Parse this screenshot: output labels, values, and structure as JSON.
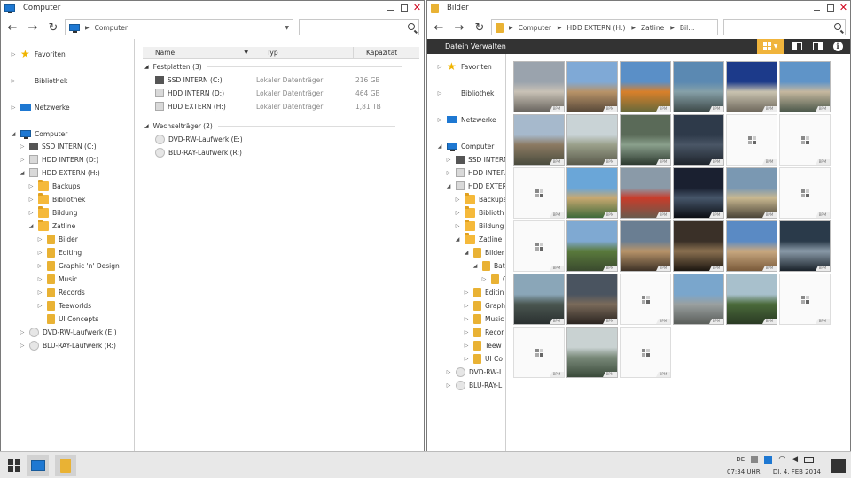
{
  "left_window": {
    "title": "Computer",
    "address": [
      "Computer"
    ],
    "tree": [
      {
        "label": "Favoriten",
        "icon": "star-icon",
        "level": 0,
        "expander": "collapsed"
      },
      {
        "label": "Bibliothek",
        "icon": "library-icon",
        "level": 0,
        "expander": "collapsed"
      },
      {
        "label": "Netzwerke",
        "icon": "network-icon",
        "level": 0,
        "expander": "collapsed"
      },
      {
        "label": "Computer",
        "icon": "monitor-icon",
        "level": 0,
        "expander": "expanded"
      },
      {
        "label": "SSD INTERN (C:)",
        "icon": "ssd-icon",
        "level": 1,
        "expander": "collapsed"
      },
      {
        "label": "HDD INTERN (D:)",
        "icon": "drive-icon",
        "level": 1,
        "expander": "collapsed"
      },
      {
        "label": "HDD EXTERN (H:)",
        "icon": "drive-icon",
        "level": 1,
        "expander": "expanded"
      },
      {
        "label": "Backups",
        "icon": "folder-icon",
        "level": 2,
        "expander": "collapsed"
      },
      {
        "label": "Bibliothek",
        "icon": "folder-icon",
        "level": 2,
        "expander": "collapsed"
      },
      {
        "label": "Bildung",
        "icon": "folder-icon",
        "level": 2,
        "expander": "collapsed"
      },
      {
        "label": "Zatline",
        "icon": "folder-icon",
        "level": 2,
        "expander": "expanded"
      },
      {
        "label": "Bilder",
        "icon": "book-folder-icon",
        "level": 3,
        "expander": "collapsed"
      },
      {
        "label": "Editing",
        "icon": "book-folder-icon",
        "level": 3,
        "expander": "collapsed"
      },
      {
        "label": "Graphic 'n' Design",
        "icon": "book-folder-icon",
        "level": 3,
        "expander": "collapsed"
      },
      {
        "label": "Music",
        "icon": "book-folder-icon",
        "level": 3,
        "expander": "collapsed"
      },
      {
        "label": "Records",
        "icon": "book-folder-icon",
        "level": 3,
        "expander": "collapsed"
      },
      {
        "label": "Teeworlds",
        "icon": "book-folder-icon",
        "level": 3,
        "expander": "collapsed"
      },
      {
        "label": "UI Concepts",
        "icon": "book-folder-icon",
        "level": 3,
        "expander": "none"
      },
      {
        "label": "DVD-RW-Laufwerk (E:)",
        "icon": "disc-icon",
        "level": 1,
        "expander": "collapsed"
      },
      {
        "label": "BLU-RAY-Laufwerk (R:)",
        "icon": "disc-icon",
        "level": 1,
        "expander": "collapsed"
      }
    ],
    "columns": [
      "Name",
      "Typ",
      "Kapazität"
    ],
    "groups": [
      {
        "label": "Festplatten (3)",
        "items": [
          {
            "name": "SSD INTERN (C:)",
            "type": "Lokaler Datenträger",
            "capacity": "216 GB",
            "icon": "ssd-icon"
          },
          {
            "name": "HDD INTERN (D:)",
            "type": "Lokaler Datenträger",
            "capacity": "464 GB",
            "icon": "drive-icon"
          },
          {
            "name": "HDD EXTERN (H:)",
            "type": "Lokaler Datenträger",
            "capacity": "1,81 TB",
            "icon": "drive-icon"
          }
        ]
      },
      {
        "label": "Wechselträger (2)",
        "items": [
          {
            "name": "DVD-RW-Laufwerk (E:)",
            "type": "",
            "capacity": "",
            "icon": "disc-icon"
          },
          {
            "name": "BLU-RAY-Laufwerk (R:)",
            "type": "",
            "capacity": "",
            "icon": "disc-icon"
          }
        ]
      }
    ]
  },
  "right_window": {
    "title": "Bilder",
    "address": [
      "Computer",
      "HDD EXTERN (H:)",
      "Zatline",
      "Bil..."
    ],
    "toolbar_label": "Datein Verwalten",
    "tree": [
      {
        "label": "Favoriten",
        "icon": "star-icon",
        "level": 0,
        "expander": "collapsed"
      },
      {
        "label": "Bibliothek",
        "icon": "library-icon",
        "level": 0,
        "expander": "collapsed"
      },
      {
        "label": "Netzwerke",
        "icon": "network-icon",
        "level": 0,
        "expander": "collapsed"
      },
      {
        "label": "Computer",
        "icon": "monitor-icon",
        "level": 0,
        "expander": "expanded"
      },
      {
        "label": "SSD INTERN",
        "icon": "ssd-icon",
        "level": 1,
        "expander": "collapsed"
      },
      {
        "label": "HDD INTER",
        "icon": "drive-icon",
        "level": 1,
        "expander": "collapsed"
      },
      {
        "label": "HDD EXTER",
        "icon": "drive-icon",
        "level": 1,
        "expander": "expanded"
      },
      {
        "label": "Backups",
        "icon": "folder-icon",
        "level": 2,
        "expander": "collapsed"
      },
      {
        "label": "Biblioth",
        "icon": "folder-icon",
        "level": 2,
        "expander": "collapsed"
      },
      {
        "label": "Bildung",
        "icon": "folder-icon",
        "level": 2,
        "expander": "collapsed"
      },
      {
        "label": "Zatline",
        "icon": "folder-icon",
        "level": 2,
        "expander": "expanded"
      },
      {
        "label": "Bilder",
        "icon": "book-folder-icon",
        "level": 3,
        "expander": "expanded"
      },
      {
        "label": "Bat",
        "icon": "book-folder-icon",
        "level": 4,
        "expander": "expanded"
      },
      {
        "label": "C",
        "icon": "book-folder-icon",
        "level": 5,
        "expander": "collapsed"
      },
      {
        "label": "Editin",
        "icon": "book-folder-icon",
        "level": 3,
        "expander": "collapsed"
      },
      {
        "label": "Graph",
        "icon": "book-folder-icon",
        "level": 3,
        "expander": "collapsed"
      },
      {
        "label": "Music",
        "icon": "book-folder-icon",
        "level": 3,
        "expander": "collapsed"
      },
      {
        "label": "Recor",
        "icon": "book-folder-icon",
        "level": 3,
        "expander": "collapsed"
      },
      {
        "label": "Teew",
        "icon": "book-folder-icon",
        "level": 3,
        "expander": "collapsed"
      },
      {
        "label": "UI Co",
        "icon": "book-folder-icon",
        "level": 3,
        "expander": "collapsed"
      },
      {
        "label": "DVD-RW-L",
        "icon": "disc-icon",
        "level": 1,
        "expander": "collapsed"
      },
      {
        "label": "BLU-RAY-L",
        "icon": "disc-icon",
        "level": 1,
        "expander": "collapsed"
      }
    ],
    "thumbnail_tag": "BPM",
    "thumbnails": [
      {
        "kind": "photo",
        "colors": [
          "#9aa3ad",
          "#c9c2b6",
          "#6a6660"
        ]
      },
      {
        "kind": "photo",
        "colors": [
          "#7fa9d6",
          "#b89368",
          "#5a4a3a"
        ]
      },
      {
        "kind": "photo",
        "colors": [
          "#5a8fc7",
          "#d9802a",
          "#6a6a3a"
        ]
      },
      {
        "kind": "photo",
        "colors": [
          "#5b89b2",
          "#86a0a8",
          "#3e4a4a"
        ]
      },
      {
        "kind": "photo",
        "colors": [
          "#1c3a8a",
          "#c9c3b0",
          "#706a5e"
        ]
      },
      {
        "kind": "photo",
        "colors": [
          "#5f94c8",
          "#c6b89f",
          "#4e5a4c"
        ]
      },
      {
        "kind": "photo",
        "colors": [
          "#a6b9cc",
          "#8c7a62",
          "#4a4c3e"
        ]
      },
      {
        "kind": "photo",
        "colors": [
          "#c9d3d6",
          "#9aa08a",
          "#5a5a4c"
        ]
      },
      {
        "kind": "photo",
        "colors": [
          "#5a6a58",
          "#8aa08c",
          "#2e3a30"
        ]
      },
      {
        "kind": "photo",
        "colors": [
          "#2e3a4a",
          "#4a5666",
          "#1e242c"
        ]
      },
      {
        "kind": "placeholder"
      },
      {
        "kind": "placeholder"
      },
      {
        "kind": "placeholder"
      },
      {
        "kind": "photo",
        "colors": [
          "#6aa6d8",
          "#c8a870",
          "#3e6a3a"
        ]
      },
      {
        "kind": "photo",
        "colors": [
          "#8a9aa8",
          "#c83c2a",
          "#6a5a4c"
        ]
      },
      {
        "kind": "photo",
        "colors": [
          "#1a2030",
          "#46566a",
          "#0c0e14"
        ]
      },
      {
        "kind": "photo",
        "colors": [
          "#7a98b2",
          "#c9b890",
          "#4a4438"
        ]
      },
      {
        "kind": "placeholder"
      },
      {
        "kind": "placeholder"
      },
      {
        "kind": "photo",
        "colors": [
          "#7fa9d2",
          "#5a7a3c",
          "#3a4a2e"
        ]
      },
      {
        "kind": "photo",
        "colors": [
          "#6a7e92",
          "#b8946a",
          "#3e3226"
        ]
      },
      {
        "kind": "photo",
        "colors": [
          "#3a3028",
          "#8a7050",
          "#1c1610"
        ]
      },
      {
        "kind": "photo",
        "colors": [
          "#5a8ac4",
          "#c8a880",
          "#7a5a3a"
        ]
      },
      {
        "kind": "photo",
        "colors": [
          "#2a3a4a",
          "#8a9aa8",
          "#1a222a"
        ]
      },
      {
        "kind": "photo",
        "colors": [
          "#8aa6b8",
          "#4a5650",
          "#2a3030"
        ]
      },
      {
        "kind": "photo",
        "colors": [
          "#4a5460",
          "#7a6a5a",
          "#2a2420"
        ]
      },
      {
        "kind": "placeholder"
      },
      {
        "kind": "photo",
        "colors": [
          "#7aa6cc",
          "#9aa0a0",
          "#5a5e5a"
        ]
      },
      {
        "kind": "photo",
        "colors": [
          "#a8c0cc",
          "#4a6a3a",
          "#2a3a24"
        ]
      },
      {
        "kind": "placeholder"
      },
      {
        "kind": "placeholder"
      },
      {
        "kind": "photo",
        "colors": [
          "#c9d2d2",
          "#7a8a7a",
          "#3a4a3a"
        ]
      },
      {
        "kind": "placeholder"
      }
    ]
  },
  "taskbar": {
    "lang": "DE",
    "time": "07:34 UHR",
    "date": "DI, 4. FEB 2014"
  },
  "colors": {
    "accent": "#f0b43c",
    "title_close": "#d0021b",
    "toolbar_dark": "#333333"
  }
}
